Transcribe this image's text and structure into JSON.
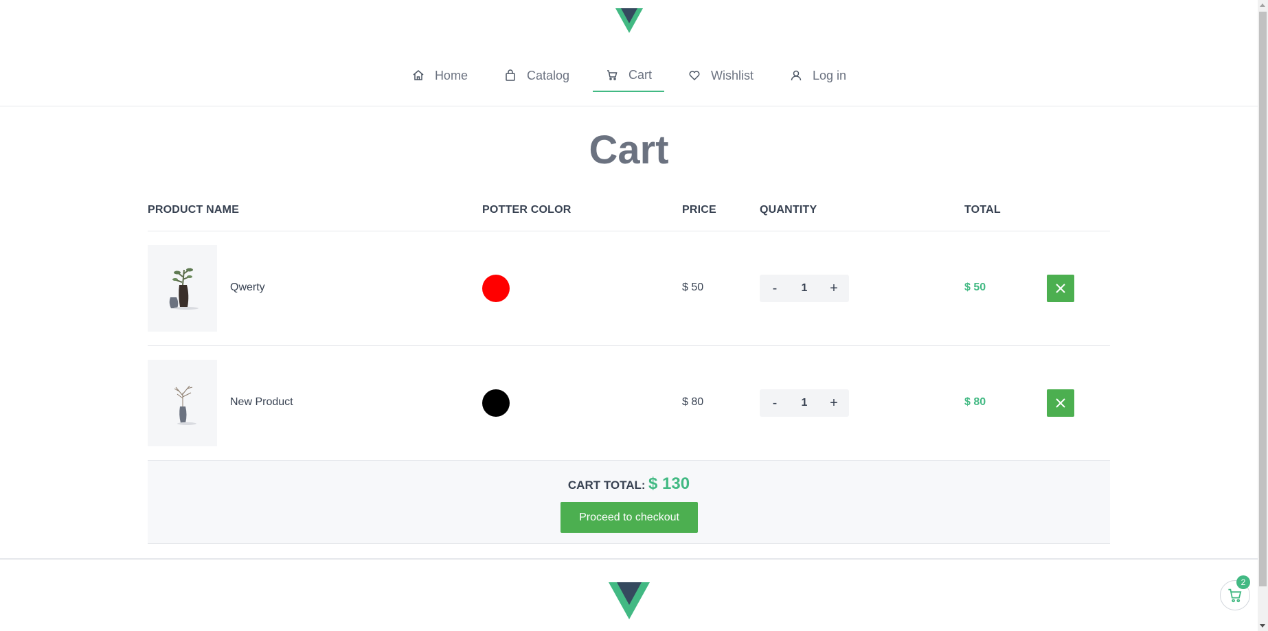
{
  "nav": {
    "items": [
      {
        "label": "Home",
        "icon": "home-icon"
      },
      {
        "label": "Catalog",
        "icon": "bag-icon"
      },
      {
        "label": "Cart",
        "icon": "cart-icon",
        "active": true
      },
      {
        "label": "Wishlist",
        "icon": "heart-icon"
      },
      {
        "label": "Log in",
        "icon": "user-icon"
      }
    ]
  },
  "page": {
    "title": "Cart"
  },
  "table": {
    "headers": [
      "PRODUCT NAME",
      "POTTER COLOR",
      "PRICE",
      "QUANTITY",
      "TOTAL"
    ],
    "rows": [
      {
        "name": "Qwerty",
        "color": "#ff0000",
        "price": "$ 50",
        "qty": "1",
        "total": "$ 50",
        "minus": "-",
        "plus": "+"
      },
      {
        "name": "New Product",
        "color": "#000000",
        "price": "$ 80",
        "qty": "1",
        "total": "$ 80",
        "minus": "-",
        "plus": "+"
      }
    ]
  },
  "summary": {
    "label": "CART TOTAL:",
    "value": "$ 130",
    "checkout_label": "Proceed to checkout"
  },
  "float_cart": {
    "count": "2"
  },
  "colors": {
    "accent": "#42b983",
    "button": "#4caf50",
    "logo_dark": "#35495e"
  }
}
